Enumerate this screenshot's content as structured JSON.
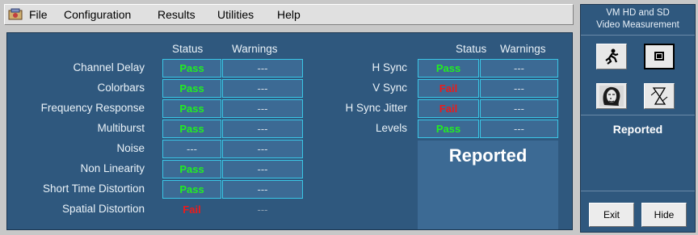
{
  "menu": {
    "items": [
      "File",
      "Configuration",
      "Results",
      "Utilities",
      "Help"
    ]
  },
  "left_table": {
    "headers": {
      "status": "Status",
      "warnings": "Warnings"
    },
    "rows": [
      {
        "label": "Channel Delay",
        "status": "Pass",
        "warnings": "---"
      },
      {
        "label": "Colorbars",
        "status": "Pass",
        "warnings": "---"
      },
      {
        "label": "Frequency Response",
        "status": "Pass",
        "warnings": "---"
      },
      {
        "label": "Multiburst",
        "status": "Pass",
        "warnings": "---"
      },
      {
        "label": "Noise",
        "status": "---",
        "warnings": "---"
      },
      {
        "label": "Non Linearity",
        "status": "Pass",
        "warnings": "---"
      },
      {
        "label": "Short Time Distortion",
        "status": "Pass",
        "warnings": "---"
      },
      {
        "label": "Spatial Distortion",
        "status": "Fail",
        "warnings": "---"
      }
    ]
  },
  "right_table": {
    "headers": {
      "status": "Status",
      "warnings": "Warnings"
    },
    "rows": [
      {
        "label": "H Sync",
        "status": "Pass",
        "warnings": "---"
      },
      {
        "label": "V Sync",
        "status": "Fail",
        "warnings": "---"
      },
      {
        "label": "H Sync Jitter",
        "status": "Fail",
        "warnings": "---"
      },
      {
        "label": "Levels",
        "status": "Pass",
        "warnings": "---"
      }
    ]
  },
  "main_status": "Reported",
  "side_panel": {
    "title_line1": "VM HD and SD",
    "title_line2": "Video Measurement",
    "status": "Reported",
    "exit_label": "Exit",
    "hide_label": "Hide"
  },
  "colors": {
    "panel_bg": "#2f587e",
    "cell_bg": "#3c6a94",
    "cell_border": "#3ac6e6",
    "pass": "#22ee22",
    "fail": "#ee1a1a"
  },
  "icons": [
    "app-logo-icon",
    "run-icon",
    "stop-icon",
    "face-icon",
    "hourglass-icon"
  ]
}
